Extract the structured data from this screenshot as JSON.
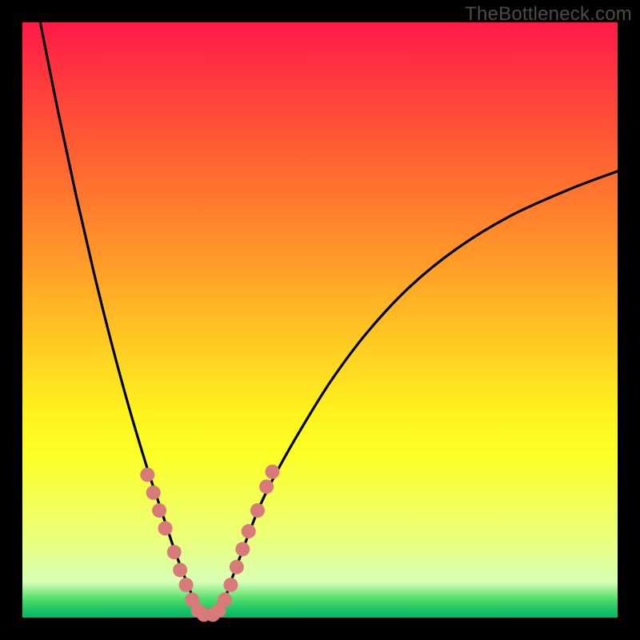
{
  "watermark": "TheBottleneck.com",
  "chart_data": {
    "type": "line",
    "title": "",
    "xlabel": "",
    "ylabel": "",
    "xlim": [
      0,
      100
    ],
    "ylim": [
      0,
      100
    ],
    "series": [
      {
        "name": "left-curve",
        "x": [
          3.0,
          6.0,
          9.0,
          12.0,
          15.0,
          18.0,
          21.0,
          22.5,
          24.0,
          25.5,
          27.0,
          28.0,
          29.0,
          30.0
        ],
        "y": [
          100.0,
          85.0,
          71.0,
          58.0,
          46.0,
          35.0,
          25.0,
          20.5,
          16.0,
          11.5,
          7.5,
          5.0,
          2.5,
          0.5
        ]
      },
      {
        "name": "right-curve",
        "x": [
          33.0,
          34.0,
          35.0,
          36.5,
          38.0,
          40.0,
          43.0,
          47.0,
          52.0,
          58.0,
          65.0,
          73.0,
          82.0,
          92.0,
          100.0
        ],
        "y": [
          0.5,
          3.0,
          6.0,
          10.0,
          14.0,
          19.0,
          25.0,
          32.0,
          40.0,
          48.0,
          55.5,
          62.0,
          67.5,
          72.0,
          75.0
        ]
      }
    ],
    "markers": {
      "name": "highlight-dots",
      "points": [
        {
          "x": 21.0,
          "y": 24.0
        },
        {
          "x": 22.0,
          "y": 21.0
        },
        {
          "x": 23.0,
          "y": 18.0
        },
        {
          "x": 24.0,
          "y": 15.0
        },
        {
          "x": 25.5,
          "y": 11.0
        },
        {
          "x": 26.5,
          "y": 8.0
        },
        {
          "x": 27.5,
          "y": 5.5
        },
        {
          "x": 28.5,
          "y": 3.0
        },
        {
          "x": 29.5,
          "y": 1.2
        },
        {
          "x": 30.5,
          "y": 0.5
        },
        {
          "x": 32.0,
          "y": 0.5
        },
        {
          "x": 33.0,
          "y": 1.2
        },
        {
          "x": 34.0,
          "y": 3.0
        },
        {
          "x": 35.0,
          "y": 5.5
        },
        {
          "x": 36.0,
          "y": 8.5
        },
        {
          "x": 37.0,
          "y": 11.5
        },
        {
          "x": 38.0,
          "y": 14.5
        },
        {
          "x": 39.5,
          "y": 18.0
        },
        {
          "x": 41.0,
          "y": 22.0
        },
        {
          "x": 42.0,
          "y": 24.5
        }
      ]
    },
    "marker_radius_px": 9,
    "colors": {
      "curve": "#000000",
      "marker": "#d87a7a",
      "gradient_top": "#ff1a48",
      "gradient_bottom": "#00b766"
    }
  }
}
